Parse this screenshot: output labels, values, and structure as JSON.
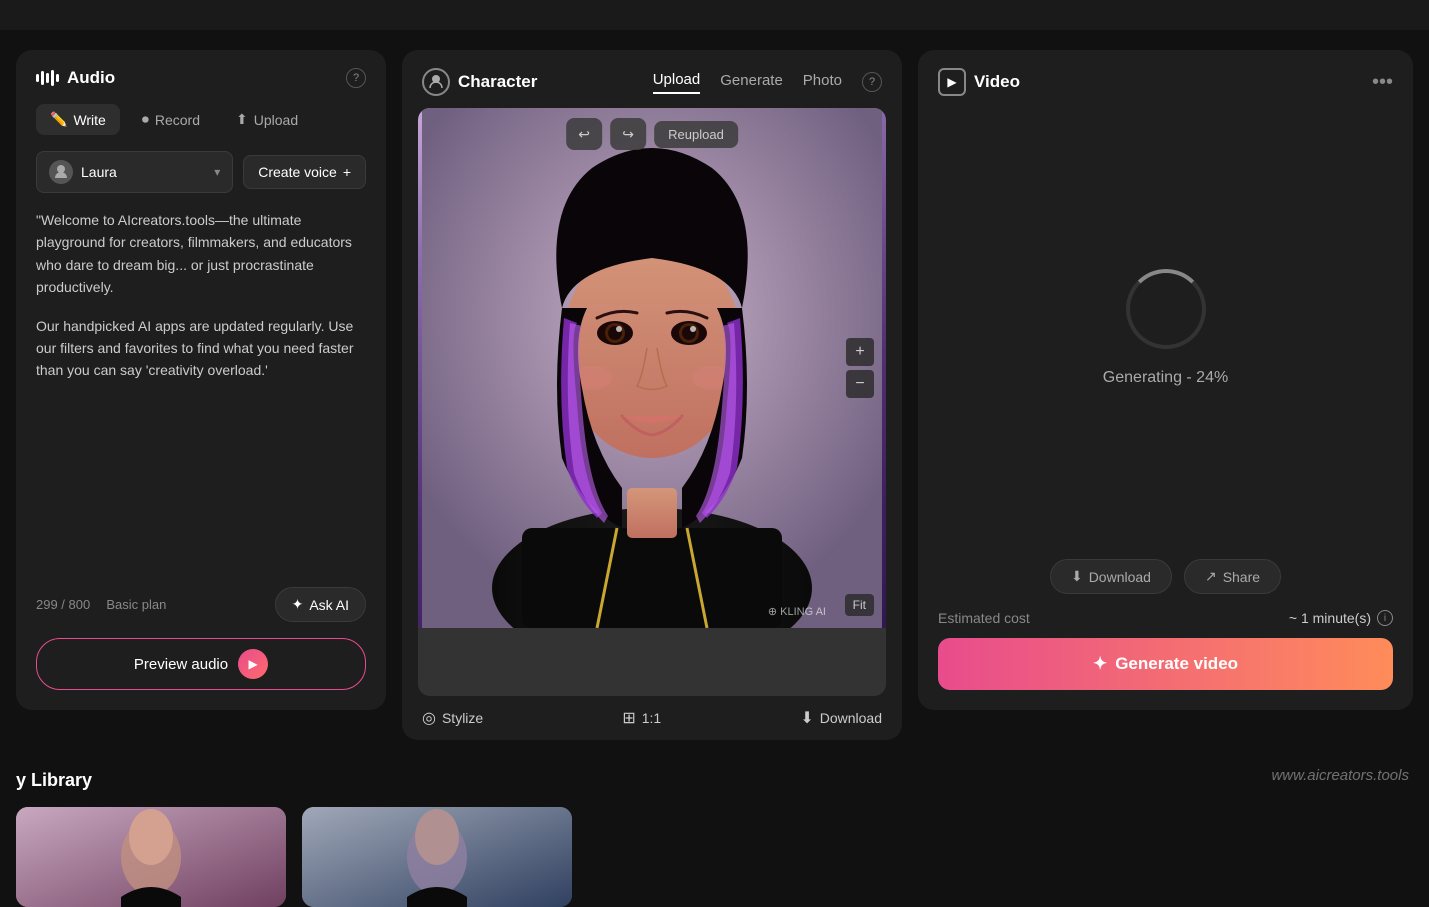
{
  "topbar": {
    "bg": "#111"
  },
  "audio": {
    "title": "Audio",
    "tabs": {
      "write": "Write",
      "record": "Record",
      "upload": "Upload"
    },
    "voice": {
      "name": "Laura",
      "create_label": "Create voice",
      "create_plus": "+"
    },
    "text_paragraphs": [
      "\"Welcome to AIcreators.tools—the ultimate playground for creators, filmmakers, and educators who dare to dream big... or just procrastinate productively.",
      "Our handpicked AI apps are updated regularly. Use our filters and favorites to find what you need faster than you can say 'creativity overload.'"
    ],
    "word_count": "299 / 800",
    "plan": "Basic plan",
    "ask_ai_label": "Ask AI",
    "preview_audio_label": "Preview audio"
  },
  "character": {
    "title": "Character",
    "tabs": [
      "Upload",
      "Generate",
      "Photo"
    ],
    "active_tab": "Upload",
    "controls": {
      "reupload": "Reupload"
    },
    "bottom_actions": {
      "stylize": "Stylize",
      "aspect": "1:1",
      "download": "Download"
    }
  },
  "video": {
    "title": "Video",
    "generating_text": "Generating - 24%",
    "progress": 24,
    "download_label": "Download",
    "share_label": "Share",
    "estimated_cost_label": "Estimated cost",
    "estimated_cost_value": "~ 1 minute(s)",
    "generate_label": "Generate video"
  },
  "library": {
    "title": "y Library"
  },
  "watermark": "www.aicreators.tools"
}
